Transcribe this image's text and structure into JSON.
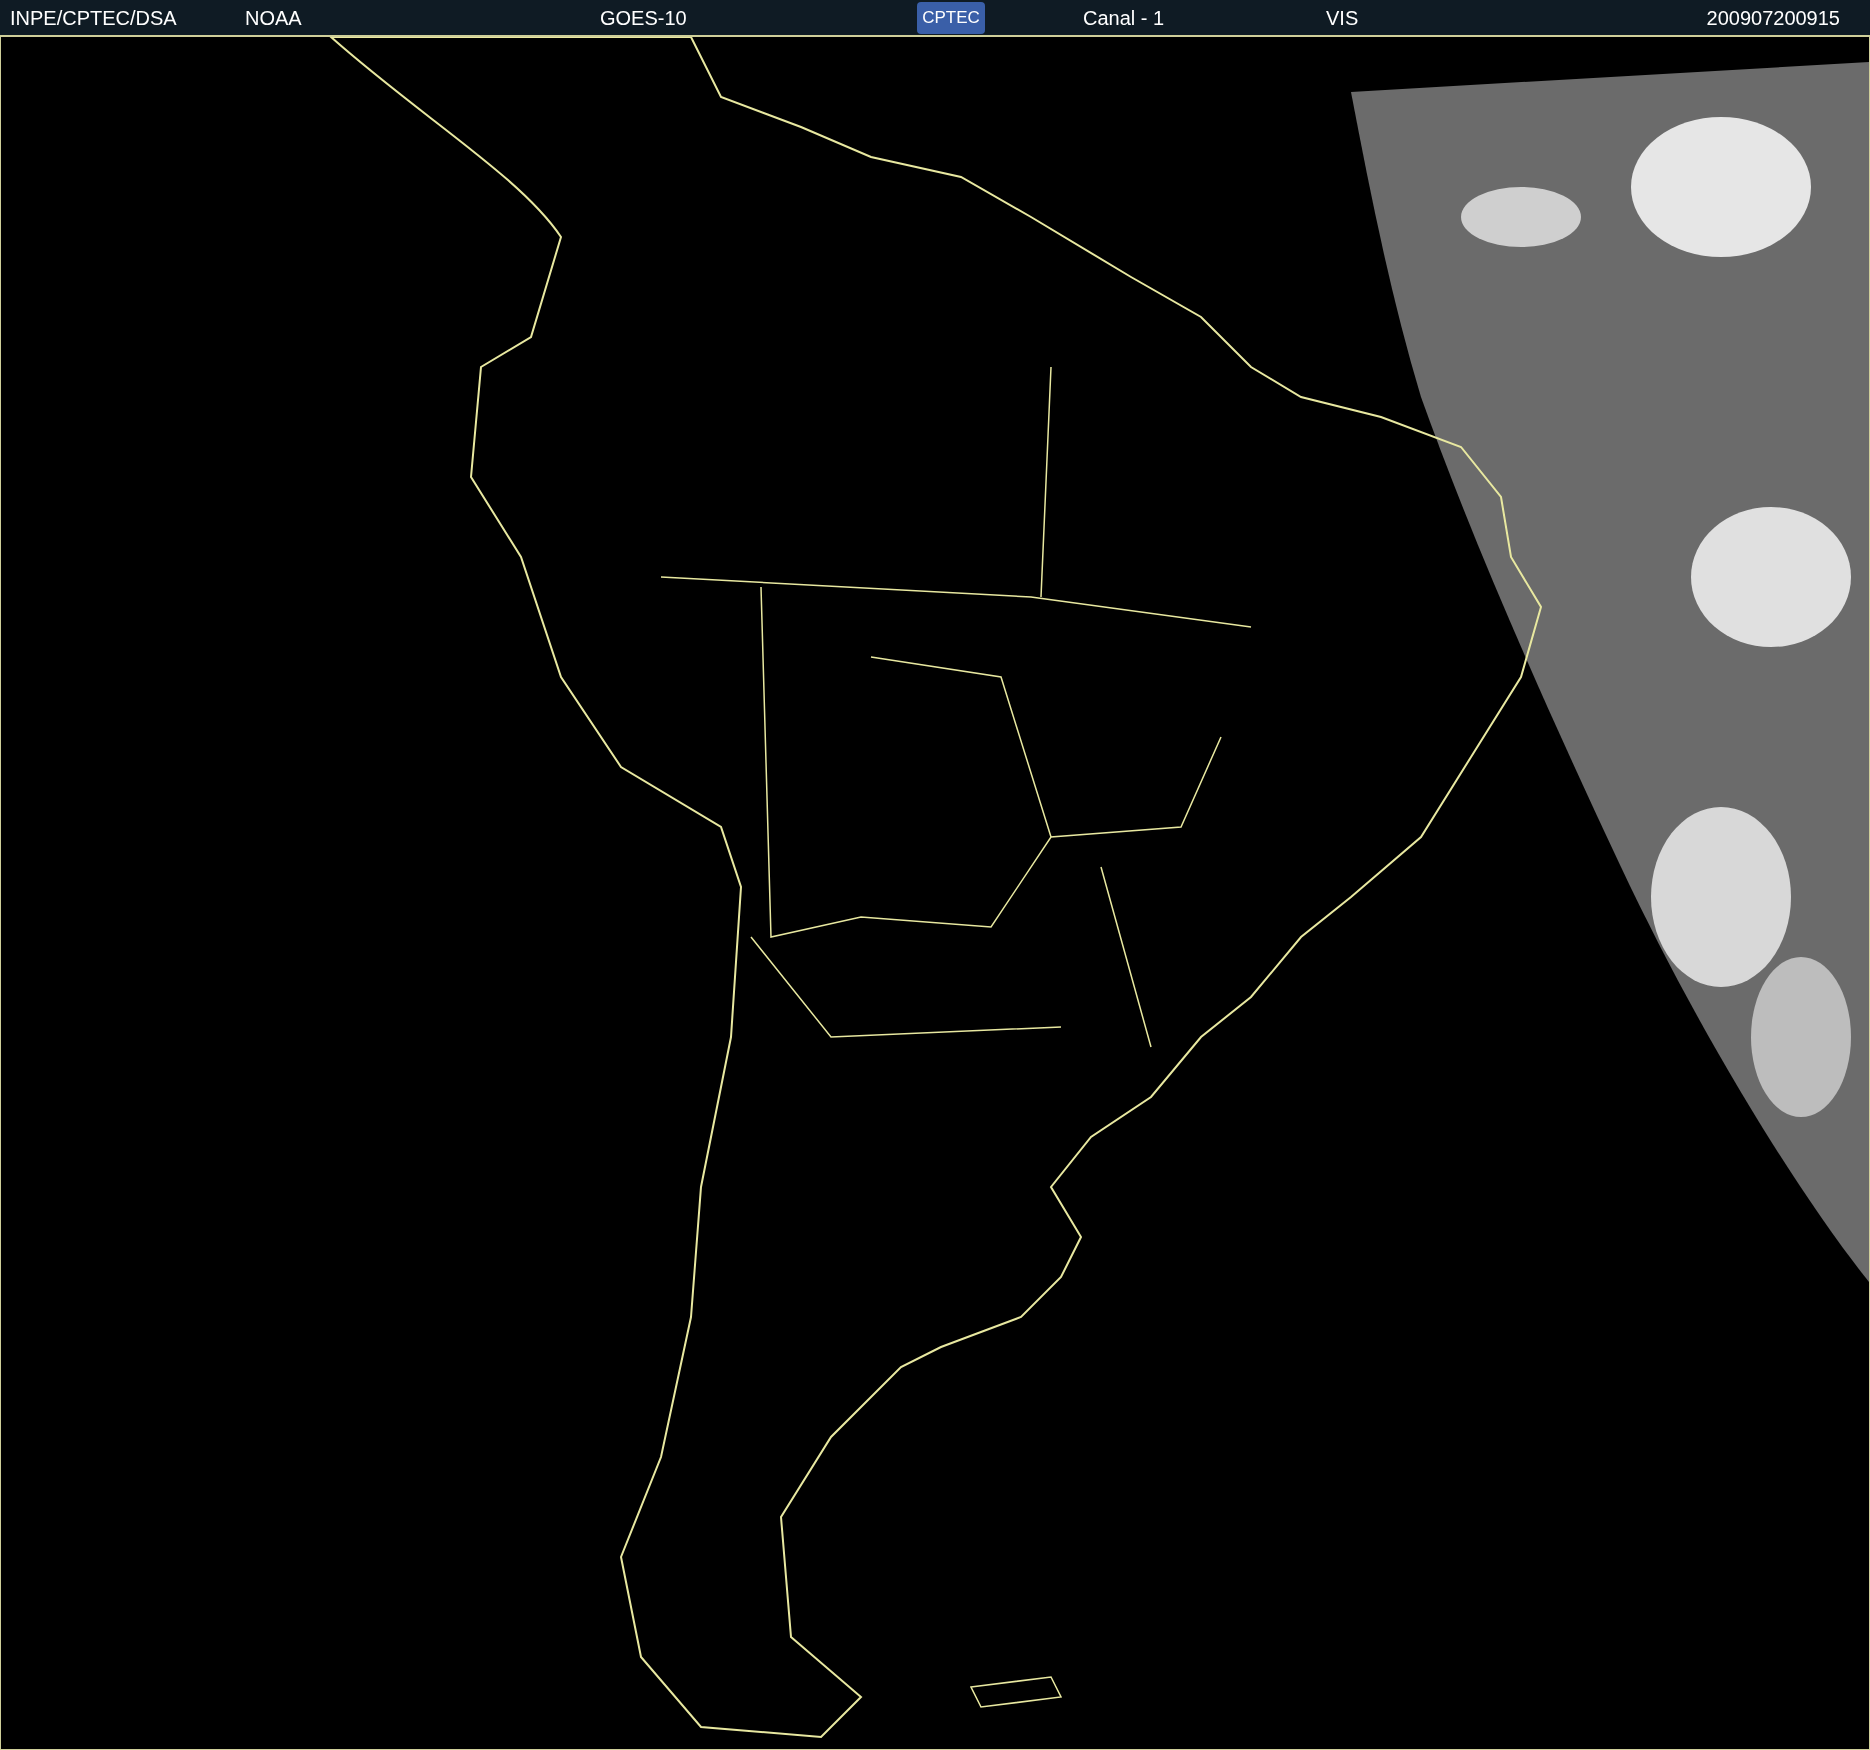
{
  "header": {
    "source": "INPE/CPTEC/DSA",
    "agency": "NOAA",
    "satellite": "GOES-10",
    "logo": "CPTEC",
    "channel": "Canal - 1",
    "band": "VIS",
    "timestamp": "200907200915"
  }
}
